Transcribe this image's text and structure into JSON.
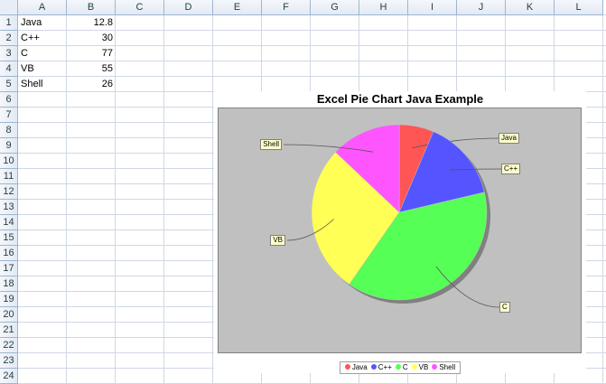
{
  "columns": [
    "A",
    "B",
    "C",
    "D",
    "E",
    "F",
    "G",
    "H",
    "I",
    "J",
    "K",
    "L"
  ],
  "rows": [
    "1",
    "2",
    "3",
    "4",
    "5",
    "6",
    "7",
    "8",
    "9",
    "10",
    "11",
    "12",
    "13",
    "14",
    "15",
    "16",
    "17",
    "18",
    "19",
    "20",
    "21",
    "22",
    "23",
    "24"
  ],
  "cells": [
    {
      "label": "Java",
      "value": "12.8"
    },
    {
      "label": "C++",
      "value": "30"
    },
    {
      "label": "C",
      "value": "77"
    },
    {
      "label": "VB",
      "value": "55"
    },
    {
      "label": "Shell",
      "value": "26"
    }
  ],
  "chart_data": {
    "type": "pie",
    "title": "Excel Pie Chart Java Example",
    "categories": [
      "Java",
      "C++",
      "C",
      "VB",
      "Shell"
    ],
    "values": [
      12.8,
      30,
      77,
      55,
      26
    ],
    "colors": [
      "#ff5555",
      "#5555ff",
      "#55ff55",
      "#ffff55",
      "#ff55ff"
    ],
    "legend": "bottom",
    "background": "#c0c0c0"
  }
}
